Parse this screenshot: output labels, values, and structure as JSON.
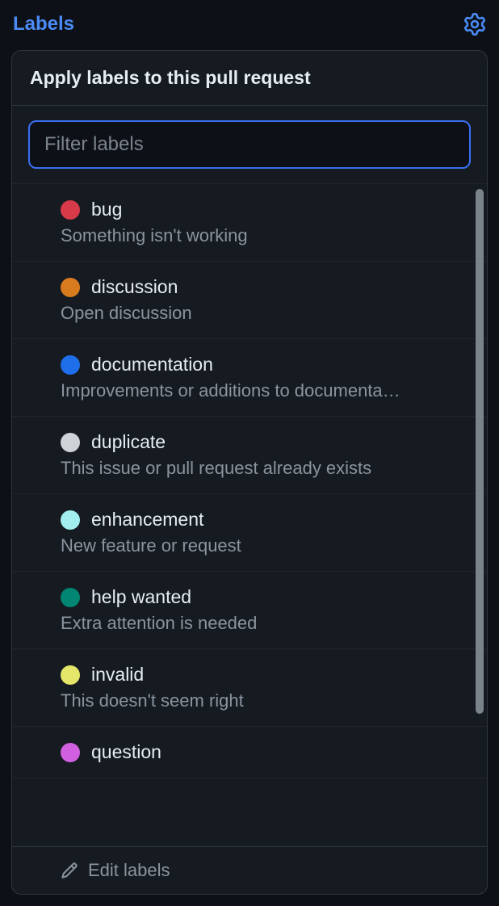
{
  "header": {
    "title": "Labels"
  },
  "panel": {
    "heading": "Apply labels to this pull request",
    "filter_placeholder": "Filter labels",
    "edit_link": "Edit labels"
  },
  "labels": [
    {
      "name": "bug",
      "description": "Something isn't working",
      "color": "#d73a49"
    },
    {
      "name": "discussion",
      "description": "Open discussion",
      "color": "#d87b1e"
    },
    {
      "name": "documentation",
      "description": "Improvements or additions to documenta…",
      "color": "#1f6feb"
    },
    {
      "name": "duplicate",
      "description": "This issue or pull request already exists",
      "color": "#cfd3d7"
    },
    {
      "name": "enhancement",
      "description": "New feature or request",
      "color": "#a2eeef"
    },
    {
      "name": "help wanted",
      "description": "Extra attention is needed",
      "color": "#008672"
    },
    {
      "name": "invalid",
      "description": "This doesn't seem right",
      "color": "#e4e669"
    },
    {
      "name": "question",
      "description": "",
      "color": "#d160e0"
    }
  ]
}
